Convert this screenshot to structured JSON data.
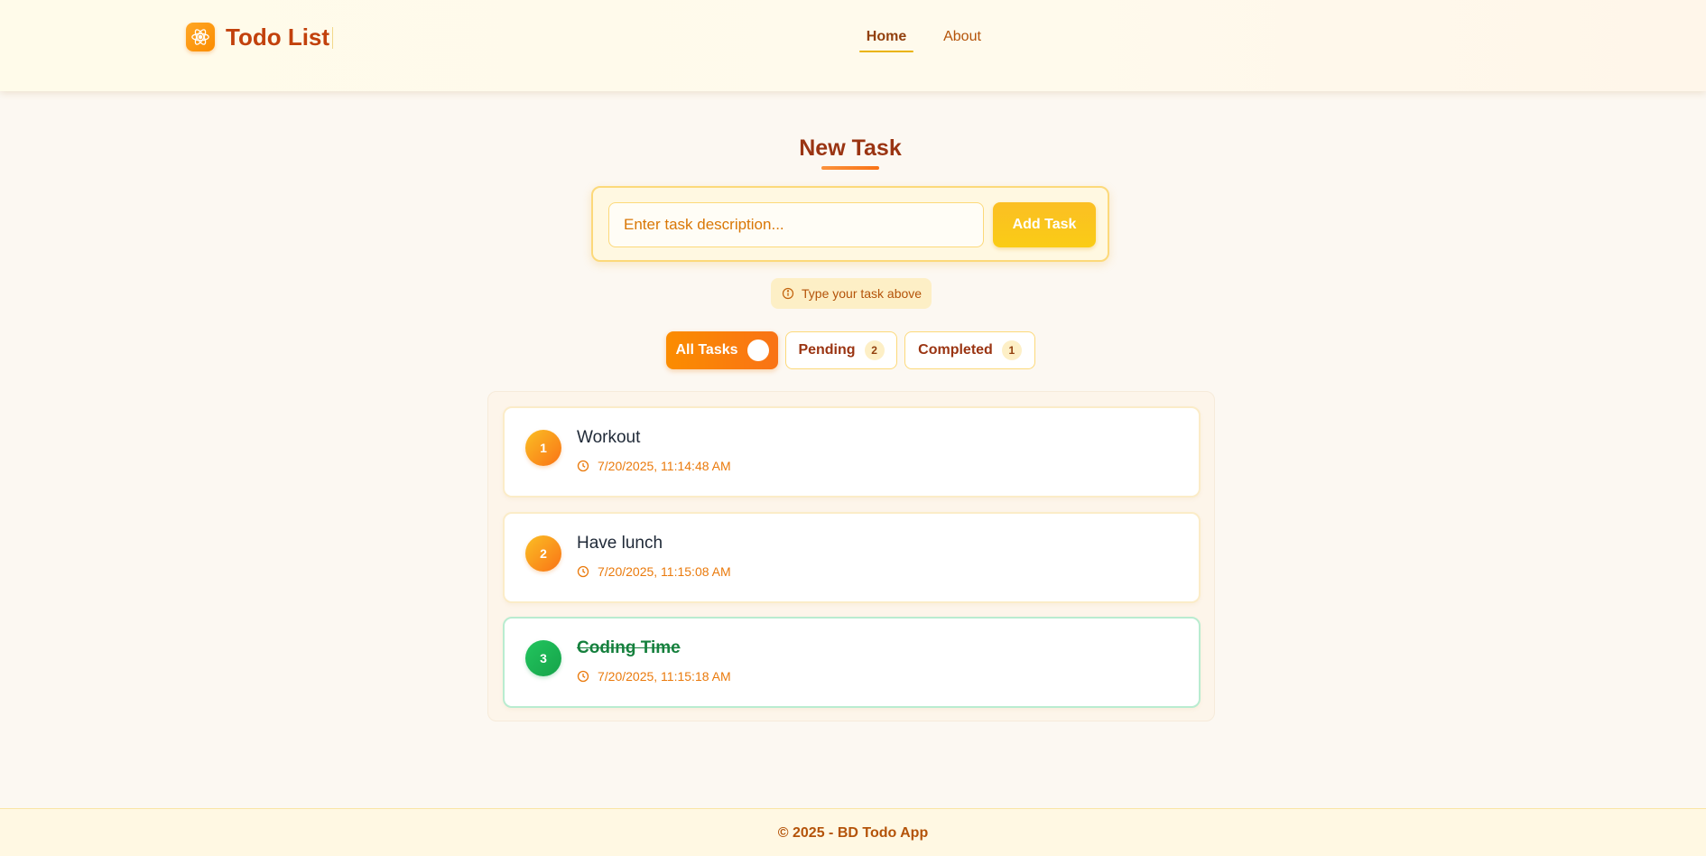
{
  "header": {
    "app_title": "Todo List",
    "logo_icon": "react-atom-icon",
    "nav": [
      {
        "label": "Home",
        "active": true
      },
      {
        "label": "About",
        "active": false
      }
    ]
  },
  "new_task": {
    "title": "New Task",
    "input_placeholder": "Enter task description...",
    "input_value": "",
    "add_label": "Add Task",
    "hint": "Type your task above"
  },
  "filters": {
    "all": {
      "label": "All Tasks",
      "count": ""
    },
    "pending": {
      "label": "Pending",
      "count": "2"
    },
    "completed": {
      "label": "Completed",
      "count": "1"
    }
  },
  "tasks": [
    {
      "number": "1",
      "name": "Workout",
      "time": "7/20/2025, 11:14:48 AM",
      "completed": false
    },
    {
      "number": "2",
      "name": "Have lunch",
      "time": "7/20/2025, 11:15:08 AM",
      "completed": false
    },
    {
      "number": "3",
      "name": "Coding Time",
      "time": "7/20/2025, 11:15:18 AM",
      "completed": true
    }
  ],
  "footer": {
    "text": "© 2025 - BD Todo App"
  },
  "colors": {
    "accent_orange": "#f97316",
    "accent_yellow": "#facc15",
    "completed_green": "#16a34a",
    "title_brown": "#9a3412"
  }
}
